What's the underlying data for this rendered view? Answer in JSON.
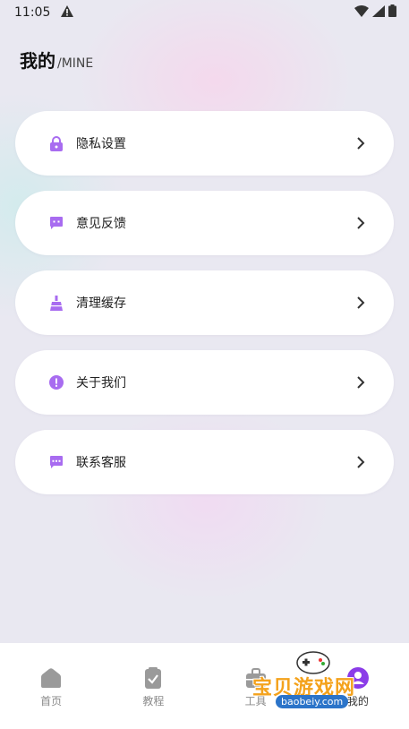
{
  "status_bar": {
    "time": "11:05",
    "icons": [
      "alert-icon",
      "wifi-icon",
      "signal-icon",
      "battery-icon"
    ]
  },
  "header": {
    "title": "我的",
    "subtitle": "/MINE"
  },
  "menu": {
    "items": [
      {
        "label": "隐私设置",
        "icon": "lock-icon"
      },
      {
        "label": "意见反馈",
        "icon": "feedback-icon"
      },
      {
        "label": "清理缓存",
        "icon": "broom-icon"
      },
      {
        "label": "关于我们",
        "icon": "info-icon"
      },
      {
        "label": "联系客服",
        "icon": "chat-icon"
      }
    ]
  },
  "tab_bar": {
    "items": [
      {
        "label": "首页",
        "icon": "home-icon"
      },
      {
        "label": "教程",
        "icon": "checklist-icon"
      },
      {
        "label": "工具",
        "icon": "toolbox-icon"
      },
      {
        "label": "我的",
        "icon": "profile-icon",
        "active": true
      }
    ]
  },
  "watermark": {
    "text": "宝贝游戏网",
    "url": "baobeiy.com"
  },
  "colors": {
    "accent": "#a86cf0",
    "background": "#e9e8f1",
    "card": "#ffffff",
    "watermark_orange": "#f4a21c"
  }
}
